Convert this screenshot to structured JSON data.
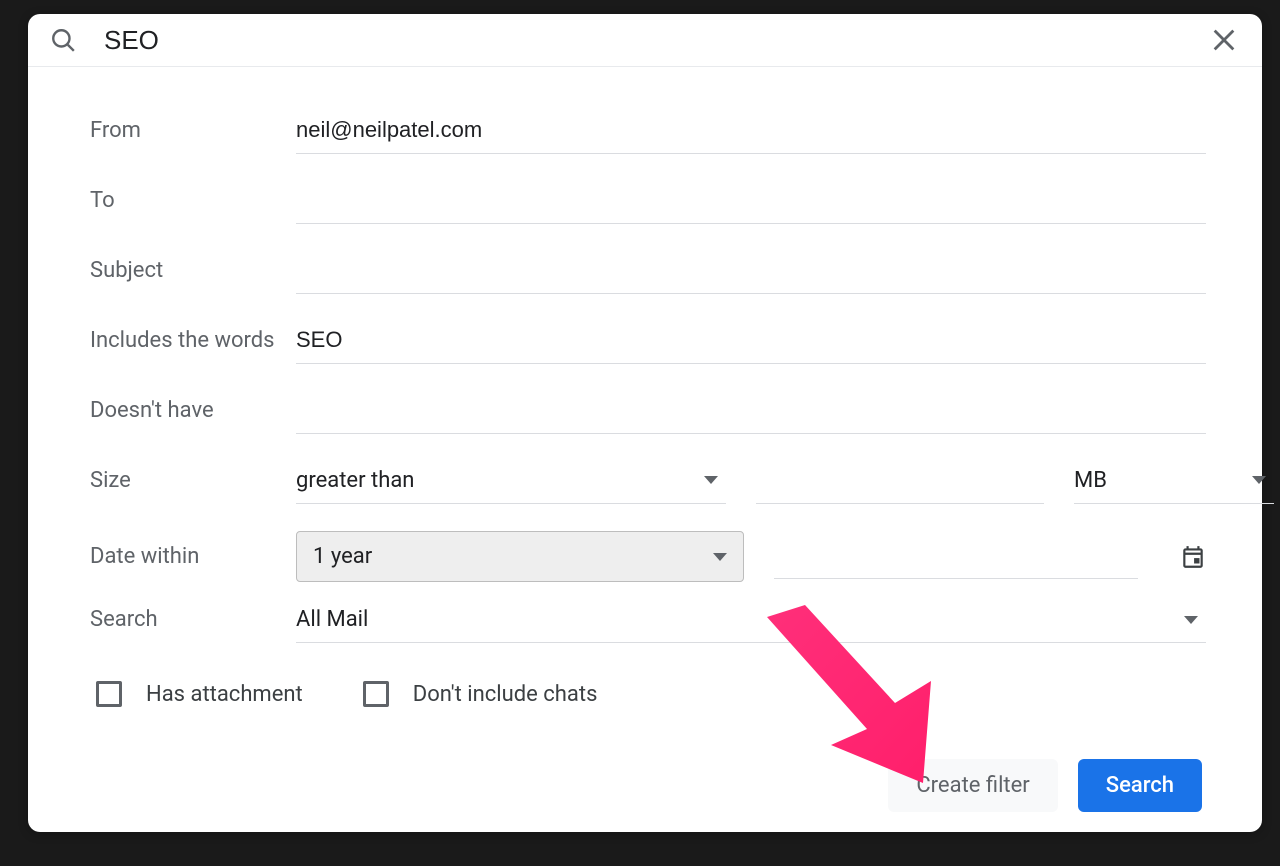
{
  "search": {
    "query": "SEO"
  },
  "filter": {
    "labels": {
      "from": "From",
      "to": "To",
      "subject": "Subject",
      "includes": "Includes the words",
      "excludes": "Doesn't have",
      "size": "Size",
      "date": "Date within",
      "search_scope": "Search"
    },
    "values": {
      "from": "neil@neilpatel.com",
      "to": "",
      "subject": "",
      "includes": "SEO",
      "excludes": "",
      "size_comparator": "greater than",
      "size_amount": "",
      "size_unit": "MB",
      "date_range": "1 year",
      "date_value": "",
      "search_scope": "All Mail"
    },
    "checkboxes": {
      "has_attachment_label": "Has attachment",
      "exclude_chats_label": "Don't include chats"
    },
    "buttons": {
      "create_filter": "Create filter",
      "search": "Search"
    }
  }
}
